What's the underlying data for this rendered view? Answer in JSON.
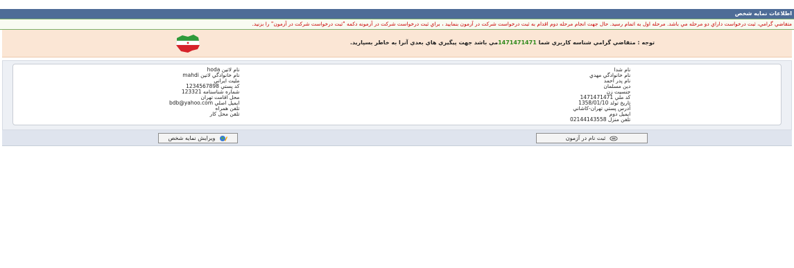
{
  "header": {
    "title": "اطلاعات نمایه شخص"
  },
  "notice": {
    "text": "متقاضي گرامي، ثبت درخواست داراي دو مرحله مي باشد. مرحله اول به اتمام رسيد. حال جهت انجام مرحله دوم اقدام به ثبت درخواست شركت در آزمون بنماييد ، براي ثبت درخواست شركت در آزمونه دكمه \"ثبت درخواست شركت در آزمون\" را بزنيد."
  },
  "alert": {
    "prefix": "توجه : متقاضي گرامي شناسه كاربري شما",
    "code": "1471471471",
    "suffix": "مي باشد جهت پيگيري هاي بعدي آنرا به خاطر بسپاريد."
  },
  "info": {
    "right": [
      "نام شدا",
      "نام خانوادگي مهدي",
      "نام پدر احمد",
      "دين مسلمان",
      "جنسيت زن",
      "كد ملي 1471471471",
      "تاريخ تولد 1358/01/10",
      "آدرس پستي تهران-كاشاني",
      "ايميل دوم",
      "تلفن منزل 02144143558"
    ],
    "left": [
      "نام لاتين hoda",
      "نام خانوادگي لاتين mahdi",
      "مليت ايراني",
      "كد پستي 1234567898",
      "شماره شناسنامه 123321",
      "محل اقامت تهران",
      "ايميل اصلي bdb@yahoo.com",
      "تلفن همراه",
      "تلفن محل كار"
    ]
  },
  "actions": {
    "edit_label": "ويرايش نمايه شخص",
    "register_label": "ثبت نام در آزمون"
  },
  "colors": {
    "header_bg": "#4e6c97",
    "notice_text": "#cc0000",
    "alert_bg": "#fbe6d5",
    "code": "#2f8a1c"
  }
}
